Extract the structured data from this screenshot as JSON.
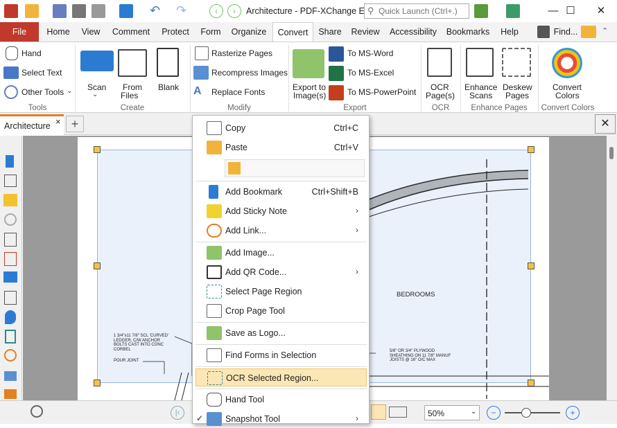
{
  "window": {
    "title": "Architecture - PDF-XChange E...",
    "search_placeholder": "Quick Launch (Ctrl+.)",
    "controls": {
      "minimize": "—",
      "maximize": "☐",
      "close": "✕"
    }
  },
  "ribbon_tabs": [
    "File",
    "Home",
    "View",
    "Comment",
    "Protect",
    "Form",
    "Organize",
    "Convert",
    "Share",
    "Review",
    "Accessibility",
    "Bookmarks",
    "Help"
  ],
  "ribbon_right": {
    "find_label": "Find..."
  },
  "ribbon": {
    "tools": {
      "hand": "Hand",
      "select_text": "Select Text",
      "other_tools": "Other Tools",
      "group": "Tools"
    },
    "create": {
      "scan": "Scan",
      "from_files_1": "From",
      "from_files_2": "Files",
      "blank": "Blank",
      "group": "Create"
    },
    "modify": {
      "rasterize": "Rasterize Pages",
      "recompress": "Recompress Images",
      "replace_fonts": "Replace Fonts",
      "group": "Modify"
    },
    "export": {
      "export_img_1": "Export to",
      "export_img_2": "Image(s)",
      "to_word": "To MS-Word",
      "to_excel": "To MS-Excel",
      "to_ppt": "To MS-PowerPoint",
      "group": "Export"
    },
    "ocr": {
      "label_1": "OCR",
      "label_2": "Page(s)",
      "group": "OCR"
    },
    "enhance": {
      "scans_1": "Enhance",
      "scans_2": "Scans",
      "deskew_1": "Deskew",
      "deskew_2": "Pages",
      "group": "Enhance Pages"
    },
    "convert_colors": {
      "label_1": "Convert",
      "label_2": "Colors",
      "group": "Convert Colors"
    }
  },
  "doc_tab": {
    "name": "Architecture",
    "close": "×",
    "add": "+"
  },
  "drawing": {
    "bedrooms": "BEDROOMS",
    "note_left": "1 3/4\"x11 7/8\" SCL 'CURVED'\nLEDGER, C/W ANCHOR\nBOLTS CAST INTO CONC\nCORBEL",
    "pour_joint": "POUR JOINT",
    "note_right": "5/8\" OR 3/4\" PLYWOOD\nSHEATHING ON 11 7/8\" MANUF\nJOISTS @ 16\" O/C MAX"
  },
  "context_menu": [
    {
      "label": "Copy",
      "shortcut": "Ctrl+C",
      "icon": "copy-icon"
    },
    {
      "label": "Paste",
      "shortcut": "Ctrl+V",
      "icon": "paste-icon"
    },
    {
      "label": "Add Bookmark",
      "shortcut": "Ctrl+Shift+B",
      "icon": "bookmark-add-icon"
    },
    {
      "label": "Add Sticky Note",
      "submenu": "›",
      "icon": "sticky-note-icon"
    },
    {
      "label": "Add Link...",
      "submenu": "›",
      "icon": "link-add-icon"
    },
    {
      "label": "Add Image...",
      "icon": "image-add-icon"
    },
    {
      "label": "Add QR Code...",
      "submenu": "›",
      "icon": "qr-code-icon"
    },
    {
      "label": "Select Page Region",
      "icon": "select-region-icon"
    },
    {
      "label": "Crop Page Tool",
      "icon": "crop-icon"
    },
    {
      "label": "Save as Logo...",
      "icon": "logo-icon"
    },
    {
      "label": "Find Forms in Selection",
      "icon": "find-forms-icon"
    },
    {
      "label": "OCR Selected Region...",
      "icon": "ocr-region-icon"
    },
    {
      "label": "Hand Tool",
      "icon": "hand-icon"
    },
    {
      "label": "Snapshot Tool",
      "submenu": "›",
      "check": "✓",
      "icon": "snapshot-icon"
    }
  ],
  "status": {
    "zoom": "50%"
  },
  "colors": {
    "accent": "#c0392b",
    "highlight": "#fbe7b5",
    "tab_accent": "#e67e22"
  }
}
